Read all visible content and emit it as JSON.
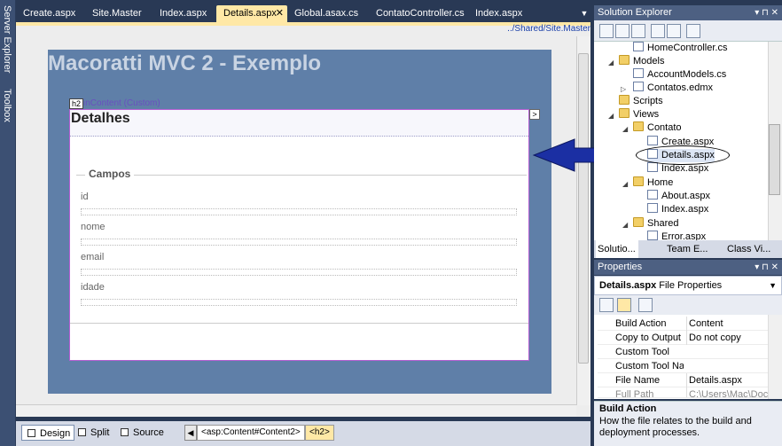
{
  "left_strip": {
    "server_explorer": "Server Explorer",
    "toolbox": "Toolbox"
  },
  "tabs": [
    {
      "label": "Create.aspx",
      "active": false
    },
    {
      "label": "Site.Master",
      "active": false
    },
    {
      "label": "Index.aspx",
      "active": false
    },
    {
      "label": "Details.aspx",
      "active": true
    },
    {
      "label": "Global.asax.cs",
      "active": false
    },
    {
      "label": "ContatoController.cs",
      "active": false
    },
    {
      "label": "Index.aspx",
      "active": false
    }
  ],
  "designer": {
    "path": "../Shared/Site.Master",
    "site_title": "Macoratti MVC 2 - Exemplo",
    "h2_tag": "h2",
    "content_tag": "inContent (Custom)",
    "heading": "Detalhes",
    "legend": "Campos",
    "fields": [
      "id",
      "nome",
      "email",
      "idade"
    ]
  },
  "bottom": {
    "design": "Design",
    "split": "Split",
    "source": "Source",
    "crumbs": [
      "<asp:Content#Content2>",
      "<h2>"
    ]
  },
  "solution_explorer": {
    "title": "Solution Explorer",
    "tree": [
      {
        "label": "HomeController.cs",
        "kind": "file"
      },
      {
        "label": "Models",
        "kind": "folder"
      },
      {
        "label": "AccountModels.cs",
        "kind": "file"
      },
      {
        "label": "Contatos.edmx",
        "kind": "file"
      },
      {
        "label": "Scripts",
        "kind": "folder"
      },
      {
        "label": "Views",
        "kind": "folder"
      },
      {
        "label": "Contato",
        "kind": "folder"
      },
      {
        "label": "Create.aspx",
        "kind": "file"
      },
      {
        "label": "Details.aspx",
        "kind": "file"
      },
      {
        "label": "Index.aspx",
        "kind": "file"
      },
      {
        "label": "Home",
        "kind": "folder"
      },
      {
        "label": "About.aspx",
        "kind": "file"
      },
      {
        "label": "Index.aspx",
        "kind": "file"
      },
      {
        "label": "Shared",
        "kind": "folder"
      },
      {
        "label": "Error.aspx",
        "kind": "file"
      }
    ],
    "bottom_tabs": [
      "Solutio...",
      "Team E...",
      "Class Vi..."
    ]
  },
  "properties": {
    "title": "Properties",
    "object_name": "Details.aspx",
    "object_type": "File Properties",
    "rows": [
      {
        "name": "Build Action",
        "value": "Content"
      },
      {
        "name": "Copy to Output D",
        "value": "Do not copy"
      },
      {
        "name": "Custom Tool",
        "value": ""
      },
      {
        "name": "Custom Tool Nam",
        "value": ""
      },
      {
        "name": "File Name",
        "value": "Details.aspx"
      },
      {
        "name": "Full Path",
        "value": "C:\\Users\\Mac\\Docu"
      }
    ],
    "desc_title": "Build Action",
    "desc_text": "How the file relates to the build and deployment processes."
  },
  "colors": {
    "accent_tab": "#ffe8a6",
    "chrome": "#293955",
    "arrow": "#1b2fa3"
  }
}
